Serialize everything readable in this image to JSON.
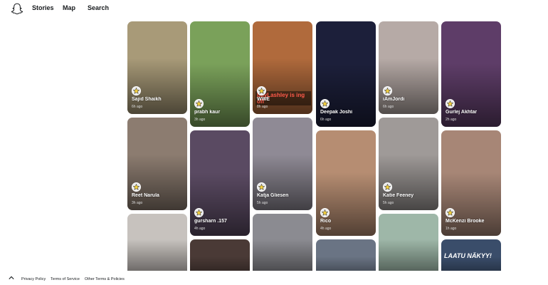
{
  "header": {
    "logo": "snapchat-ghost-icon",
    "nav": [
      "Stories",
      "Map",
      "Search"
    ]
  },
  "stories": [
    {
      "name": "Sajid Shaikh",
      "time": "6h ago",
      "bg": "#a89a78"
    },
    {
      "name": "prabh kaur",
      "time": "3h ago",
      "bg": "#7aa15a"
    },
    {
      "name": "WWE",
      "time": "8h ago",
      "bg": "#b06a3c",
      "overlay": "bbyLashley is ing off"
    },
    {
      "name": "Deepak Joshi",
      "time": "6h ago",
      "bg": "#1c1f3a"
    },
    {
      "name": "iAmJordi",
      "time": "6h ago",
      "bg": "#b6aaa6"
    },
    {
      "name": "Gurlej Akhtar",
      "time": "2h ago",
      "bg": "#5e3d68"
    },
    {
      "name": "Reet Narula",
      "time": "3h ago",
      "bg": "#8c7c70"
    },
    {
      "name": "gursharn .157",
      "time": "4h ago",
      "bg": "#5a4a62"
    },
    {
      "name": "Katja Gliesen",
      "time": "5h ago",
      "bg": "#8f8a95"
    },
    {
      "name": "Rico",
      "time": "4h ago",
      "bg": "#b68d72"
    },
    {
      "name": "Katie Feeney",
      "time": "5h ago",
      "bg": "#9f9a98"
    },
    {
      "name": "McKenzi Brooke",
      "time": "1h ago",
      "bg": "#a78676"
    },
    {
      "name": "",
      "time": "",
      "bg": "#c7c2be"
    },
    {
      "name": "",
      "time": "",
      "bg": "#4a3a36"
    },
    {
      "name": "",
      "time": "",
      "bg": "#8b8b91"
    },
    {
      "name": "",
      "time": "",
      "bg": "#6a7484"
    },
    {
      "name": "",
      "time": "",
      "bg": "#9eb7a8"
    },
    {
      "name": "",
      "time": "",
      "bg": "#3a4d6a",
      "overlay": "LAATU NÄKYY!"
    }
  ],
  "footer": {
    "links": [
      "Privacy Policy",
      "Terms of Service",
      "Other Terms & Policies"
    ]
  }
}
